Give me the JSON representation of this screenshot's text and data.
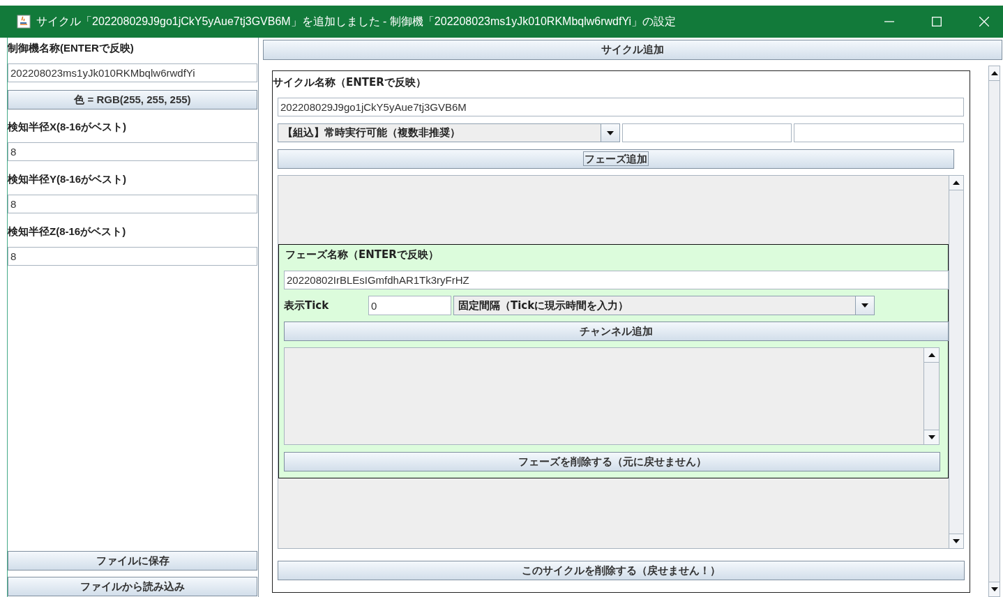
{
  "window": {
    "title": "サイクル「202208029J9go1jCkY5yAue7tj3GVB6M」を追加しました - 制御機「202208023ms1yJk010RKMbqlw6rwdfYi」の設定"
  },
  "left_panel": {
    "name_label": "制御機名称(ENTERで反映)",
    "name_value": "202208023ms1yJk010RKMbqlw6rwdfYi",
    "color_button": "色 = RGB(255, 255, 255)",
    "radius_fields": [
      {
        "label": "検知半径X(8-16がベスト)",
        "value": "8"
      },
      {
        "label": "検知半径Y(8-16がベスト)",
        "value": "8"
      },
      {
        "label": "検知半径Z(8-16がベスト)",
        "value": "8"
      }
    ],
    "buttons": [
      "ファイルに保存",
      "ファイルから読み込み"
    ]
  },
  "add_cycle_button": "サイクル追加",
  "cycle": {
    "name_label": "サイクル名称（ENTERで反映）",
    "name_value": "202208029J9go1jCkY5yAue7tj3GVB6M",
    "type_combo": "【組込】常時実行可能（複数非推奨）",
    "add_phase_button": "フェーズ追加",
    "phases": [
      {
        "name_label": "フェーズ名称（ENTERで反映）",
        "name_value": "20220802IrBLEsIGmfdhAR1Tk3ryFrHZ",
        "tick_label": "表示Tick",
        "tick_value": "0",
        "mode_combo": "固定間隔（Tickに現示時間を入力）",
        "add_channel_button": "チャンネル追加",
        "delete_button": "フェーズを削除する（元に戻せません）"
      }
    ],
    "delete_button": "このサイクルを削除する（戻せません！）"
  }
}
